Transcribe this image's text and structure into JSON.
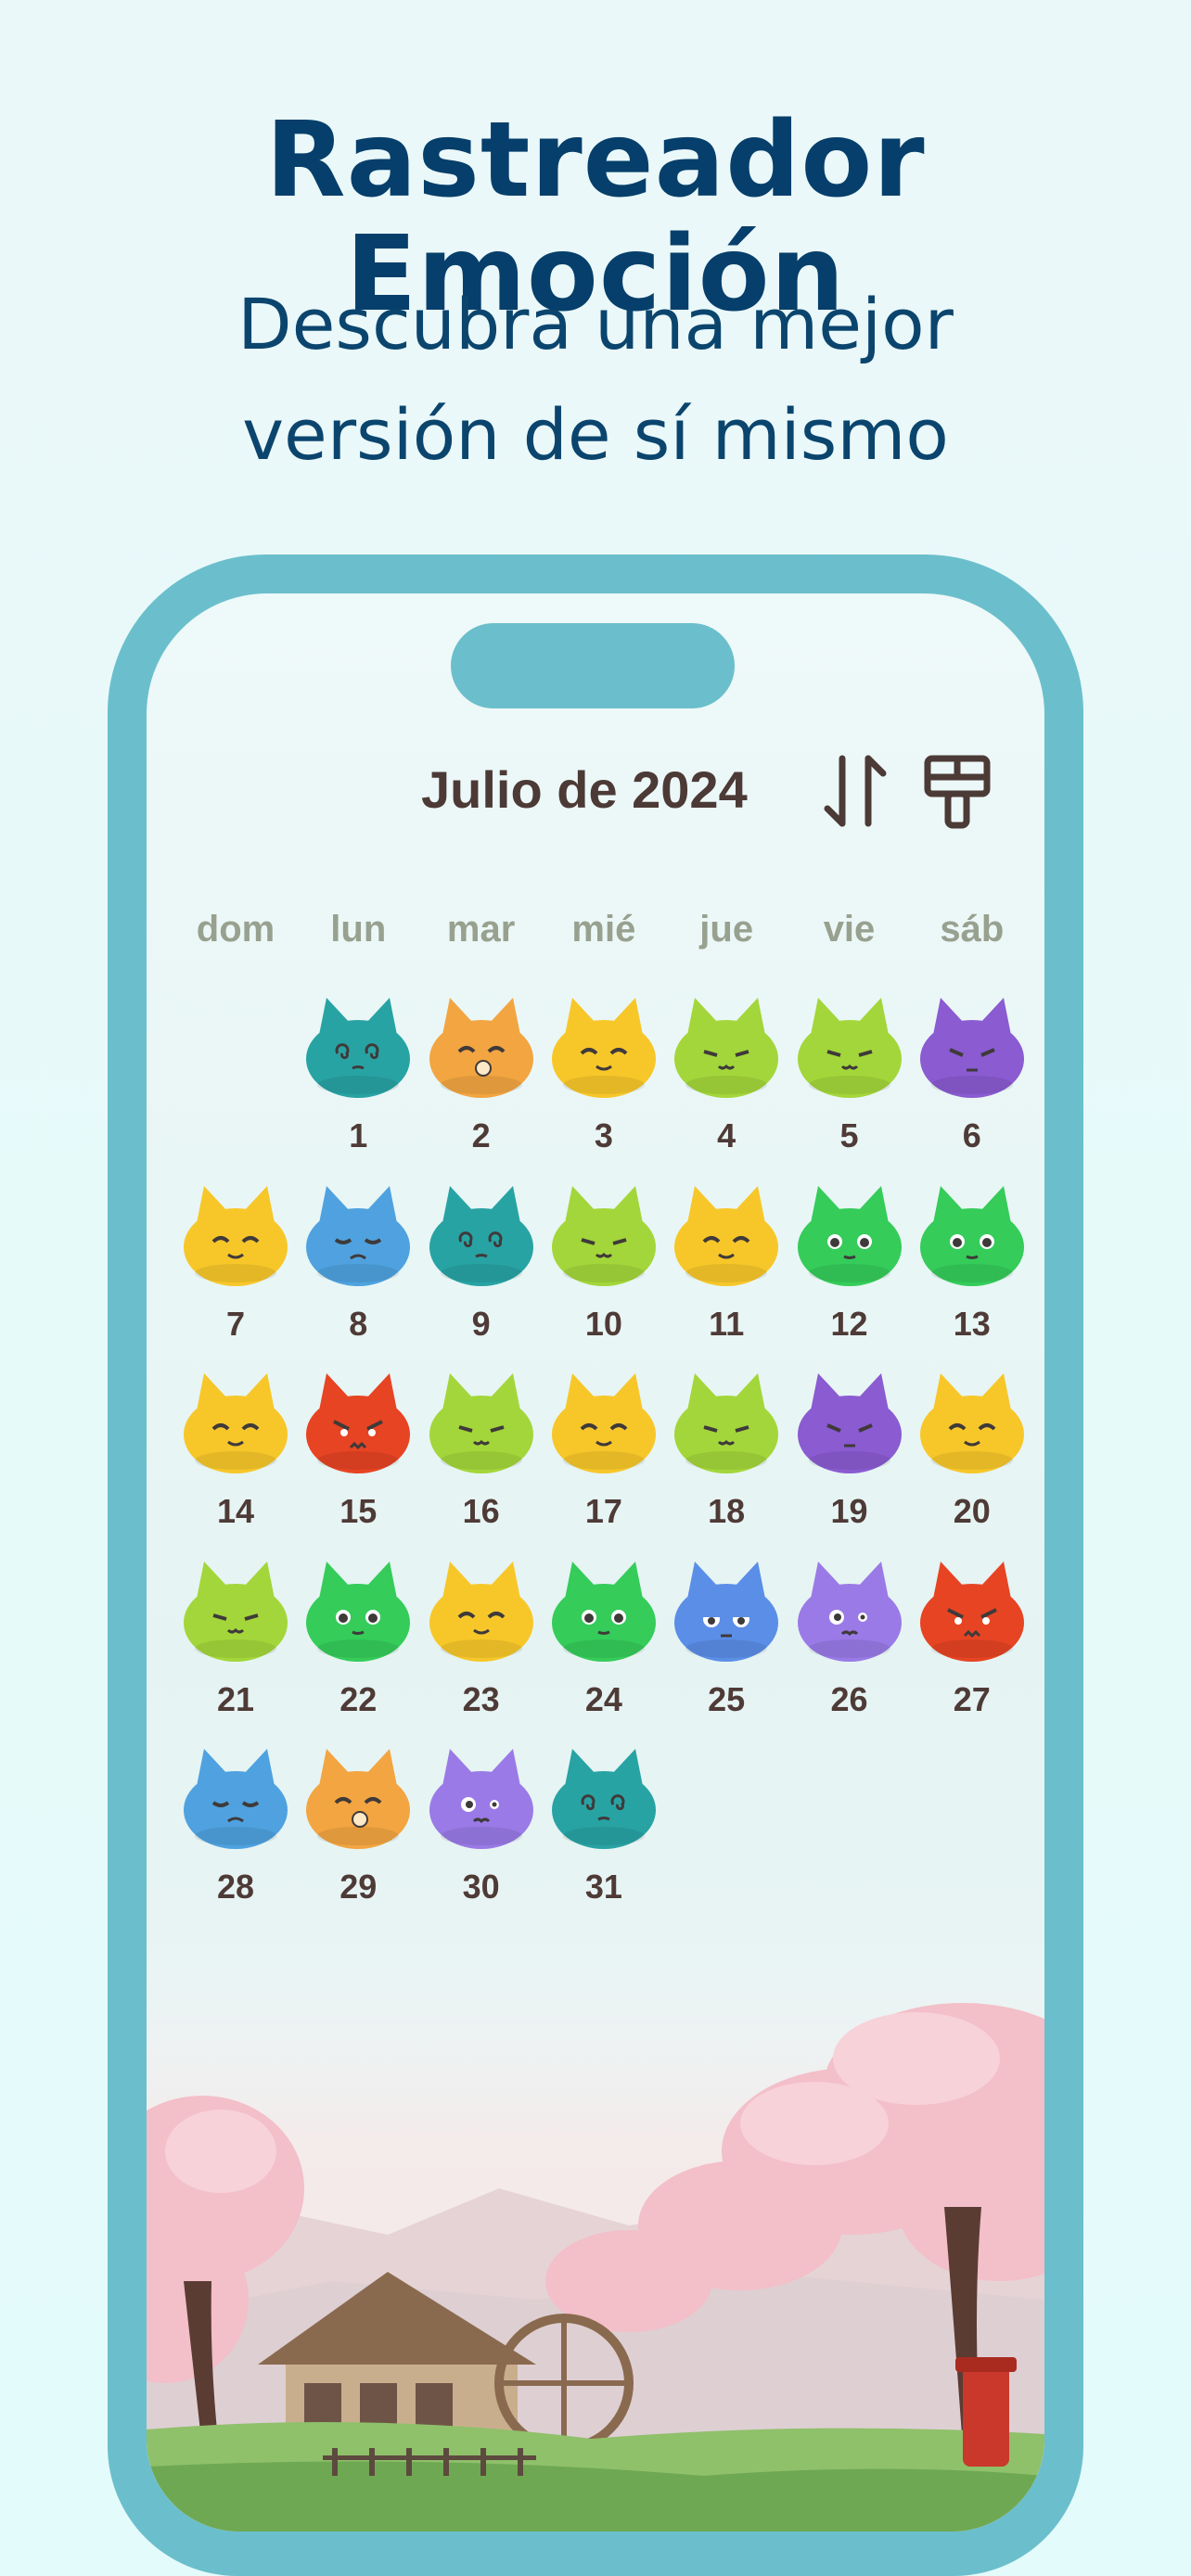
{
  "header": {
    "title": "Rastreador Emoción",
    "subtitle_line1": "Descubra una mejor",
    "subtitle_line2": "versión de sí mismo"
  },
  "calendar": {
    "month_label": "Julio de 2024",
    "sort_icon": "sort-arrows-icon",
    "theme_icon": "paint-roller-icon",
    "weekdays": [
      "dom",
      "lun",
      "mar",
      "mié",
      "jue",
      "vie",
      "sáb"
    ],
    "first_weekday_index": 1,
    "days": [
      {
        "n": "1",
        "mood": "teal",
        "face": "dizzy"
      },
      {
        "n": "2",
        "mood": "orange",
        "face": "eating"
      },
      {
        "n": "3",
        "mood": "yellow",
        "face": "happy"
      },
      {
        "n": "4",
        "mood": "lime",
        "face": "content"
      },
      {
        "n": "5",
        "mood": "lime",
        "face": "content"
      },
      {
        "n": "6",
        "mood": "purple",
        "face": "sleepy"
      },
      {
        "n": "7",
        "mood": "yellow",
        "face": "happy"
      },
      {
        "n": "8",
        "mood": "blue",
        "face": "sad"
      },
      {
        "n": "9",
        "mood": "teal",
        "face": "dizzy"
      },
      {
        "n": "10",
        "mood": "lime",
        "face": "content"
      },
      {
        "n": "11",
        "mood": "yellow",
        "face": "happy"
      },
      {
        "n": "12",
        "mood": "green",
        "face": "neutral"
      },
      {
        "n": "13",
        "mood": "green",
        "face": "neutral"
      },
      {
        "n": "14",
        "mood": "yellow",
        "face": "happy"
      },
      {
        "n": "15",
        "mood": "red",
        "face": "angry"
      },
      {
        "n": "16",
        "mood": "lime",
        "face": "content"
      },
      {
        "n": "17",
        "mood": "yellow",
        "face": "happy"
      },
      {
        "n": "18",
        "mood": "lime",
        "face": "content"
      },
      {
        "n": "19",
        "mood": "purple",
        "face": "sleepy"
      },
      {
        "n": "20",
        "mood": "yellow",
        "face": "happy"
      },
      {
        "n": "21",
        "mood": "lime",
        "face": "content"
      },
      {
        "n": "22",
        "mood": "green",
        "face": "neutral"
      },
      {
        "n": "23",
        "mood": "yellow",
        "face": "happy"
      },
      {
        "n": "24",
        "mood": "green",
        "face": "neutral"
      },
      {
        "n": "25",
        "mood": "blueviolet",
        "face": "tired"
      },
      {
        "n": "26",
        "mood": "lavender",
        "face": "worried"
      },
      {
        "n": "27",
        "mood": "red",
        "face": "angry"
      },
      {
        "n": "28",
        "mood": "blue",
        "face": "sad"
      },
      {
        "n": "29",
        "mood": "orange",
        "face": "eating"
      },
      {
        "n": "30",
        "mood": "lavender",
        "face": "worried"
      },
      {
        "n": "31",
        "mood": "teal",
        "face": "dizzy"
      }
    ]
  },
  "colors": {
    "title": "#063f6b",
    "phone_frame": "#6bbfcc",
    "weekday_text": "#98a08f",
    "day_number": "#4e3a36",
    "mood_palette": {
      "teal": "#28a3a4",
      "orange": "#f2a541",
      "yellow": "#f7c72a",
      "lime": "#a3d63a",
      "green": "#35cc5a",
      "purple": "#8a5bd1",
      "blue": "#4fa2df",
      "red": "#e74423",
      "blueviolet": "#5b8ee6",
      "lavender": "#9a7ae6"
    }
  }
}
